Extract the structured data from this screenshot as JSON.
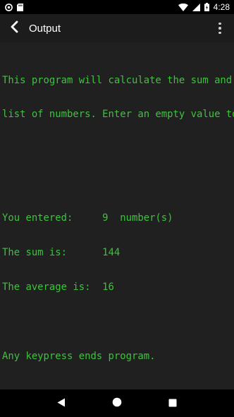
{
  "status_bar": {
    "time": "4:28",
    "icons": [
      "sync-icon",
      "sd-card-icon",
      "wifi-icon",
      "signal-icon",
      "battery-icon"
    ]
  },
  "app_bar": {
    "title": "Output",
    "icons": [
      "back-arrow-icon",
      "more-vert-icon"
    ]
  },
  "console": {
    "text_color": "#3fc13f",
    "background": "#202020",
    "lines": [
      "This program will calculate the sum and average of a",
      "list of numbers. Enter an empty value to stop.",
      "",
      "",
      "You entered:     9  number(s)",
      "The sum is:      144",
      "The average is:  16",
      "",
      "Any keypress ends program."
    ]
  },
  "nav_bar": {
    "icons": [
      "back-triangle-icon",
      "home-circle-icon",
      "recents-square-icon"
    ]
  }
}
